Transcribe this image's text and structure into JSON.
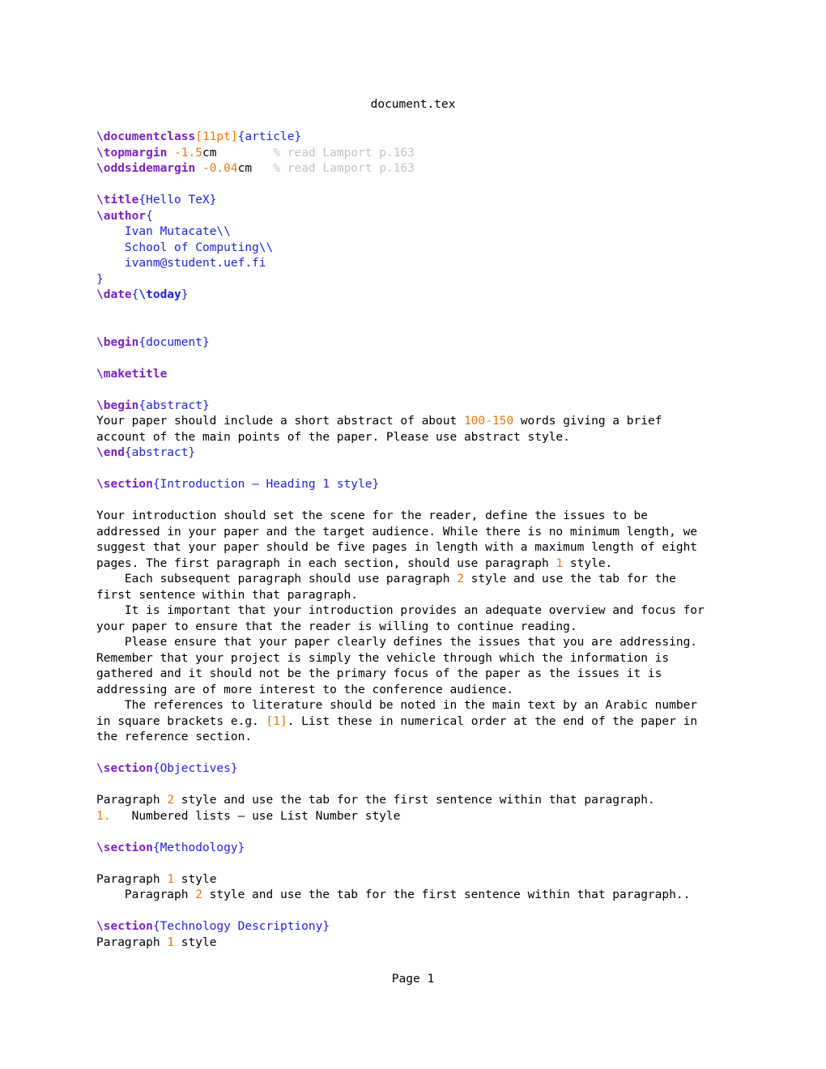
{
  "window": {
    "file_title": "document.tex",
    "footer": "Page 1"
  },
  "colors": {
    "command": "#7b21c4",
    "command_alt": "#2222dd",
    "argument": "#2222dd",
    "option": "#e8760d",
    "number": "#e8760d",
    "comment": "#c3c3c3",
    "text": "#000000",
    "background": "#ffffff"
  },
  "source": {
    "language": "latex",
    "lines": [
      {
        "n": 1,
        "segments": [
          {
            "t": "\\documentclass",
            "c": "cmd"
          },
          {
            "t": "[",
            "c": "opt"
          },
          {
            "t": "11pt",
            "c": "opt"
          },
          {
            "t": "]",
            "c": "opt"
          },
          {
            "t": "{",
            "c": "brace"
          },
          {
            "t": "article",
            "c": "arg"
          },
          {
            "t": "}",
            "c": "brace"
          }
        ]
      },
      {
        "n": 2,
        "segments": [
          {
            "t": "\\topmargin",
            "c": "cmd"
          },
          {
            "t": " -",
            "c": "num"
          },
          {
            "t": "1.5",
            "c": "num"
          },
          {
            "t": "cm",
            "c": "plain"
          },
          {
            "t": "        ",
            "c": "plain"
          },
          {
            "t": "% read Lamport p.163",
            "c": "comment"
          }
        ]
      },
      {
        "n": 3,
        "segments": [
          {
            "t": "\\oddsidemargin",
            "c": "cmd"
          },
          {
            "t": " -",
            "c": "num"
          },
          {
            "t": "0.04",
            "c": "num"
          },
          {
            "t": "cm",
            "c": "plain"
          },
          {
            "t": "   ",
            "c": "plain"
          },
          {
            "t": "% read Lamport p.163",
            "c": "comment"
          }
        ]
      },
      {
        "n": 4,
        "segments": []
      },
      {
        "n": 5,
        "segments": [
          {
            "t": "\\title",
            "c": "cmd"
          },
          {
            "t": "{",
            "c": "brace"
          },
          {
            "t": "Hello TeX",
            "c": "arg"
          },
          {
            "t": "}",
            "c": "brace"
          }
        ]
      },
      {
        "n": 6,
        "segments": [
          {
            "t": "\\author",
            "c": "cmd"
          },
          {
            "t": "{",
            "c": "brace"
          }
        ]
      },
      {
        "n": 7,
        "segments": [
          {
            "t": "    Ivan Mutacate\\\\",
            "c": "arg"
          }
        ]
      },
      {
        "n": 8,
        "segments": [
          {
            "t": "    School of Computing\\\\",
            "c": "arg"
          }
        ]
      },
      {
        "n": 9,
        "segments": [
          {
            "t": "    ivanm@student.uef.fi",
            "c": "arg"
          }
        ]
      },
      {
        "n": 10,
        "segments": [
          {
            "t": "}",
            "c": "brace"
          }
        ]
      },
      {
        "n": 11,
        "segments": [
          {
            "t": "\\date",
            "c": "cmd"
          },
          {
            "t": "{",
            "c": "brace"
          },
          {
            "t": "\\today",
            "c": "cmd2"
          },
          {
            "t": "}",
            "c": "brace"
          }
        ]
      },
      {
        "n": 12,
        "segments": []
      },
      {
        "n": 13,
        "segments": []
      },
      {
        "n": 14,
        "segments": [
          {
            "t": "\\begin",
            "c": "cmd"
          },
          {
            "t": "{",
            "c": "brace"
          },
          {
            "t": "document",
            "c": "arg"
          },
          {
            "t": "}",
            "c": "brace"
          }
        ]
      },
      {
        "n": 15,
        "segments": []
      },
      {
        "n": 16,
        "segments": [
          {
            "t": "\\maketitle",
            "c": "cmd"
          }
        ]
      },
      {
        "n": 17,
        "segments": []
      },
      {
        "n": 18,
        "segments": [
          {
            "t": "\\begin",
            "c": "cmd"
          },
          {
            "t": "{",
            "c": "brace"
          },
          {
            "t": "abstract",
            "c": "arg"
          },
          {
            "t": "}",
            "c": "brace"
          }
        ]
      },
      {
        "n": 19,
        "segments": [
          {
            "t": "Your paper should include a short abstract of about ",
            "c": "plain"
          },
          {
            "t": "100",
            "c": "num"
          },
          {
            "t": "-",
            "c": "num"
          },
          {
            "t": "150",
            "c": "num"
          },
          {
            "t": " words giving a brief",
            "c": "plain"
          }
        ]
      },
      {
        "n": 20,
        "segments": [
          {
            "t": "account of the main points of the paper. Please use abstract style.",
            "c": "plain"
          }
        ]
      },
      {
        "n": 21,
        "segments": [
          {
            "t": "\\end",
            "c": "cmd"
          },
          {
            "t": "{",
            "c": "brace"
          },
          {
            "t": "abstract",
            "c": "arg"
          },
          {
            "t": "}",
            "c": "brace"
          }
        ]
      },
      {
        "n": 22,
        "segments": []
      },
      {
        "n": 23,
        "segments": [
          {
            "t": "\\section",
            "c": "cmd"
          },
          {
            "t": "{",
            "c": "brace"
          },
          {
            "t": "Introduction – Heading 1 style",
            "c": "arg"
          },
          {
            "t": "}",
            "c": "brace"
          }
        ]
      },
      {
        "n": 24,
        "segments": []
      },
      {
        "n": 25,
        "segments": [
          {
            "t": "Your introduction should set the scene for the reader, define the issues to be",
            "c": "plain"
          }
        ]
      },
      {
        "n": 26,
        "segments": [
          {
            "t": "addressed in your paper and the target audience. While there is no minimum length, we",
            "c": "plain"
          }
        ]
      },
      {
        "n": 27,
        "segments": [
          {
            "t": "suggest that your paper should be five pages in length with a maximum length of eight",
            "c": "plain"
          }
        ]
      },
      {
        "n": 28,
        "segments": [
          {
            "t": "pages. The first paragraph in each section, should use paragraph ",
            "c": "plain"
          },
          {
            "t": "1",
            "c": "num"
          },
          {
            "t": " style.",
            "c": "plain"
          }
        ]
      },
      {
        "n": 29,
        "segments": [
          {
            "t": "    Each subsequent paragraph should use paragraph ",
            "c": "plain"
          },
          {
            "t": "2",
            "c": "num"
          },
          {
            "t": " style and use the tab for the",
            "c": "plain"
          }
        ]
      },
      {
        "n": 30,
        "segments": [
          {
            "t": "first sentence within that paragraph.",
            "c": "plain"
          }
        ]
      },
      {
        "n": 31,
        "segments": [
          {
            "t": "    It is important that your introduction provides an adequate overview and focus for",
            "c": "plain"
          }
        ]
      },
      {
        "n": 32,
        "segments": [
          {
            "t": "your paper to ensure that the reader is willing to continue reading.",
            "c": "plain"
          }
        ]
      },
      {
        "n": 33,
        "segments": [
          {
            "t": "    Please ensure that your paper clearly defines the issues that you are addressing.",
            "c": "plain"
          }
        ]
      },
      {
        "n": 34,
        "segments": [
          {
            "t": "Remember that your project is simply the vehicle through which the information is",
            "c": "plain"
          }
        ]
      },
      {
        "n": 35,
        "segments": [
          {
            "t": "gathered and it should not be the primary focus of the paper as the issues it is",
            "c": "plain"
          }
        ]
      },
      {
        "n": 36,
        "segments": [
          {
            "t": "addressing are of more interest to the conference audience.",
            "c": "plain"
          }
        ]
      },
      {
        "n": 37,
        "segments": [
          {
            "t": "    The references to literature should be noted in the main text by an Arabic number",
            "c": "plain"
          }
        ]
      },
      {
        "n": 38,
        "segments": [
          {
            "t": "in square brackets e.g. ",
            "c": "plain"
          },
          {
            "t": "[1]",
            "c": "num"
          },
          {
            "t": ". List these in numerical order at the end of the paper in",
            "c": "plain"
          }
        ]
      },
      {
        "n": 39,
        "segments": [
          {
            "t": "the reference section.",
            "c": "plain"
          }
        ]
      },
      {
        "n": 40,
        "segments": []
      },
      {
        "n": 41,
        "segments": [
          {
            "t": "\\section",
            "c": "cmd"
          },
          {
            "t": "{",
            "c": "brace"
          },
          {
            "t": "Objectives",
            "c": "arg"
          },
          {
            "t": "}",
            "c": "brace"
          }
        ]
      },
      {
        "n": 42,
        "segments": []
      },
      {
        "n": 43,
        "segments": [
          {
            "t": "Paragraph ",
            "c": "plain"
          },
          {
            "t": "2",
            "c": "num"
          },
          {
            "t": " style and use the tab for the first sentence within that paragraph.",
            "c": "plain"
          }
        ]
      },
      {
        "n": 44,
        "segments": [
          {
            "t": "1.",
            "c": "num"
          },
          {
            "t": "   Numbered lists – use List Number style",
            "c": "plain"
          }
        ]
      },
      {
        "n": 45,
        "segments": []
      },
      {
        "n": 46,
        "segments": [
          {
            "t": "\\section",
            "c": "cmd"
          },
          {
            "t": "{",
            "c": "brace"
          },
          {
            "t": "Methodology",
            "c": "arg"
          },
          {
            "t": "}",
            "c": "brace"
          }
        ]
      },
      {
        "n": 47,
        "segments": []
      },
      {
        "n": 48,
        "segments": [
          {
            "t": "Paragraph ",
            "c": "plain"
          },
          {
            "t": "1",
            "c": "num"
          },
          {
            "t": " style",
            "c": "plain"
          }
        ]
      },
      {
        "n": 49,
        "segments": [
          {
            "t": "    Paragraph ",
            "c": "plain"
          },
          {
            "t": "2",
            "c": "num"
          },
          {
            "t": " style and use the tab for the first sentence within that paragraph..",
            "c": "plain"
          }
        ]
      },
      {
        "n": 50,
        "segments": []
      },
      {
        "n": 51,
        "segments": [
          {
            "t": "\\section",
            "c": "cmd"
          },
          {
            "t": "{",
            "c": "brace"
          },
          {
            "t": "Technology Descriptiony",
            "c": "arg"
          },
          {
            "t": "}",
            "c": "brace"
          }
        ]
      },
      {
        "n": 52,
        "segments": [
          {
            "t": "Paragraph ",
            "c": "plain"
          },
          {
            "t": "1",
            "c": "num"
          },
          {
            "t": " style",
            "c": "plain"
          }
        ]
      }
    ]
  }
}
